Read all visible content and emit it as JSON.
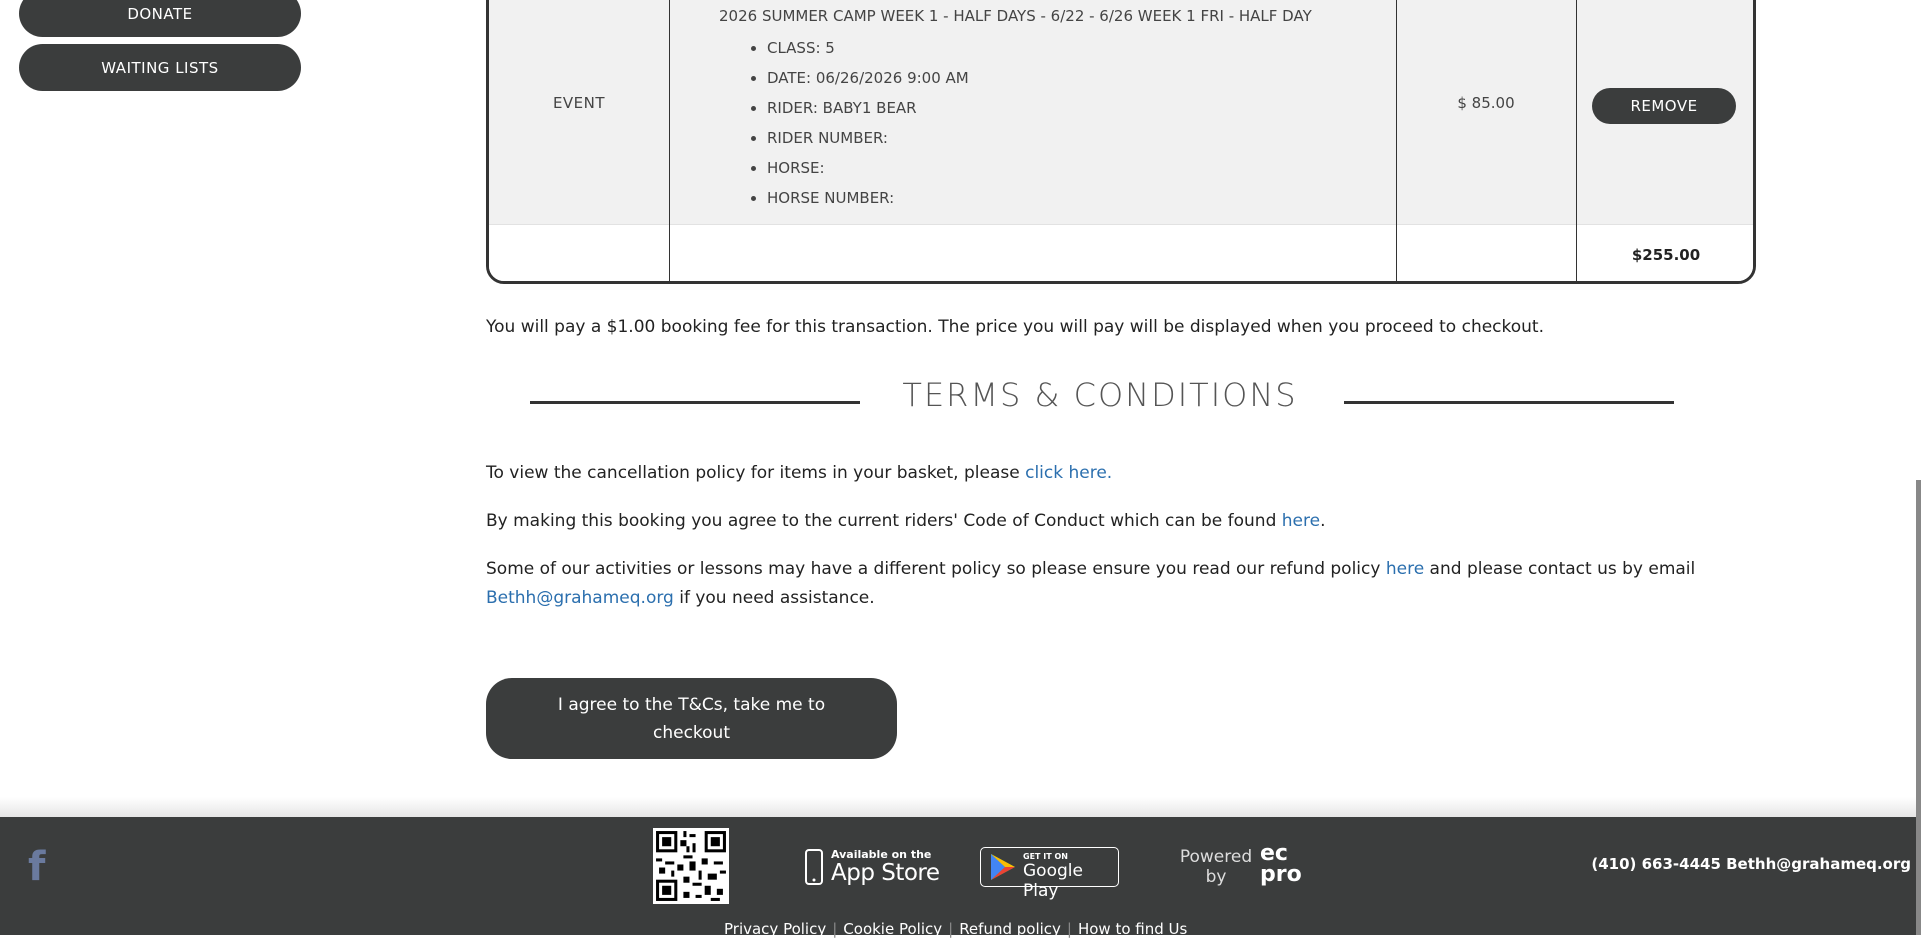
{
  "sidebar": {
    "buttons": [
      {
        "label": "DONATE"
      },
      {
        "label": "WAITING LISTS"
      }
    ]
  },
  "basket": {
    "item": {
      "type": "EVENT",
      "title": "2026 SUMMER CAMP WEEK 1 - HALF DAYS - 6/22 - 6/26 WEEK 1 FRI - HALF DAY",
      "details": [
        "CLASS: 5",
        "DATE: 06/26/2026 9:00 AM",
        "RIDER: BABY1 BEAR",
        "RIDER NUMBER:",
        "HORSE:",
        "HORSE NUMBER:"
      ],
      "price": "$ 85.00",
      "remove_label": "REMOVE"
    },
    "total": "$255.00"
  },
  "booking_fee_text": "You will pay a $1.00 booking fee for this transaction. The price you will pay will be displayed when you proceed to checkout.",
  "terms": {
    "title": "TERMS & CONDITIONS",
    "cancellation_text": "To view the cancellation policy for items in your basket, please ",
    "cancellation_link": "click here.",
    "conduct_text": "By making this booking you agree to the current riders' Code of Conduct which can be found ",
    "conduct_link": "here",
    "conduct_end": ".",
    "refund_text": "Some of our activities or lessons may have a different policy so please ensure you read our refund policy ",
    "refund_link": "here",
    "refund_mid": " and please contact us by email",
    "email_link": "Bethh@grahameq.org",
    "refund_end": " if you need assistance."
  },
  "agree_button": "I agree to the T&Cs, take me to checkout",
  "footer": {
    "facebook_icon": "facebook-icon",
    "appstore_small": "Available on the",
    "appstore_big": "App Store",
    "gplay_small": "GET IT ON",
    "gplay_big": "Google Play",
    "powered_by": "Powered by",
    "logo_top": "ec",
    "logo_bottom": "pro",
    "contact": "(410) 663-4445 Bethh@grahameq.org",
    "links": [
      "Privacy Policy",
      "Cookie Policy",
      "Refund policy",
      "How to find Us"
    ]
  }
}
